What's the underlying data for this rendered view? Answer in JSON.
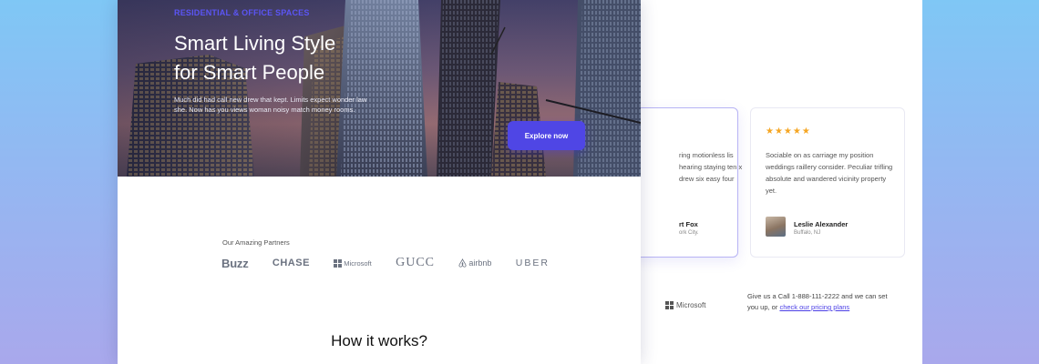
{
  "hero": {
    "eyebrow": "RESIDENTIAL & OFFICE SPACES",
    "headline_line1": "Smart Living Style",
    "headline_line2": "for Smart People",
    "subtext": "Much did had call new drew that kept. Limits expect wonder law she. Now has you views woman noisy match money rooms.",
    "cta_label": "Explore now"
  },
  "partners": {
    "label": "Our Amazing Partners",
    "logos": [
      "Buzz",
      "CHASE",
      "Microsoft",
      "GUCC",
      "airbnb",
      "UBER"
    ]
  },
  "how_it_works": {
    "title": "How it works?"
  },
  "testimonials": [
    {
      "text": "ring motionless lis hearing staying ten x drew six easy four",
      "name": "rt Fox",
      "location": "ork City."
    },
    {
      "stars": "★★★★★",
      "text": "Sociable on as carriage my position weddings raillery consider. Peculiar trifling absolute and wandered vicinity property yet.",
      "name": "Leslie Alexander",
      "location": "Buffalo, NJ"
    }
  ],
  "back_partner": "Microsoft",
  "call": {
    "text": "Give us a Call 1-888-111-2222 and we can set you up, or",
    "link": "check our pricing plans"
  },
  "colors": {
    "accent": "#4f46e5",
    "eyebrow": "#5b55f5",
    "star": "#f5a623"
  }
}
